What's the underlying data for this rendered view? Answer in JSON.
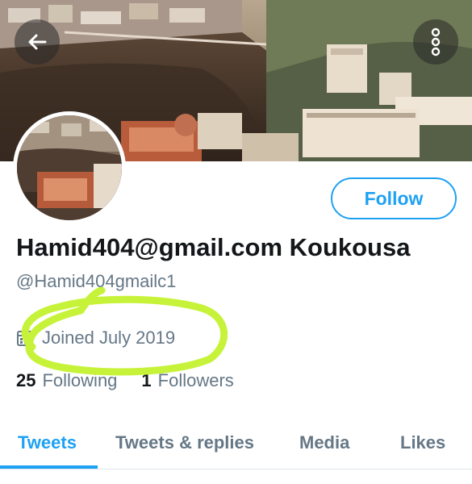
{
  "header": {
    "back_icon": "arrow-left-icon",
    "more_icon": "more-vertical-icon"
  },
  "profile": {
    "display_name": "Hamid404@gmail.com Koukousa",
    "handle": "@Hamid404gmailc1",
    "joined": "Joined July 2019",
    "joined_icon": "calendar-icon",
    "follow_label": "Follow"
  },
  "stats": {
    "following_count": "25",
    "following_label": "Following",
    "followers_count": "1",
    "followers_label": "Followers"
  },
  "tabs": [
    {
      "label": "Tweets",
      "active": true
    },
    {
      "label": "Tweets & replies",
      "active": false
    },
    {
      "label": "Media",
      "active": false
    },
    {
      "label": "Likes",
      "active": false
    }
  ],
  "colors": {
    "accent": "#1da1f2",
    "text_primary": "#14171a",
    "text_secondary": "#657786",
    "highlight_marker": "#c6f33a"
  }
}
